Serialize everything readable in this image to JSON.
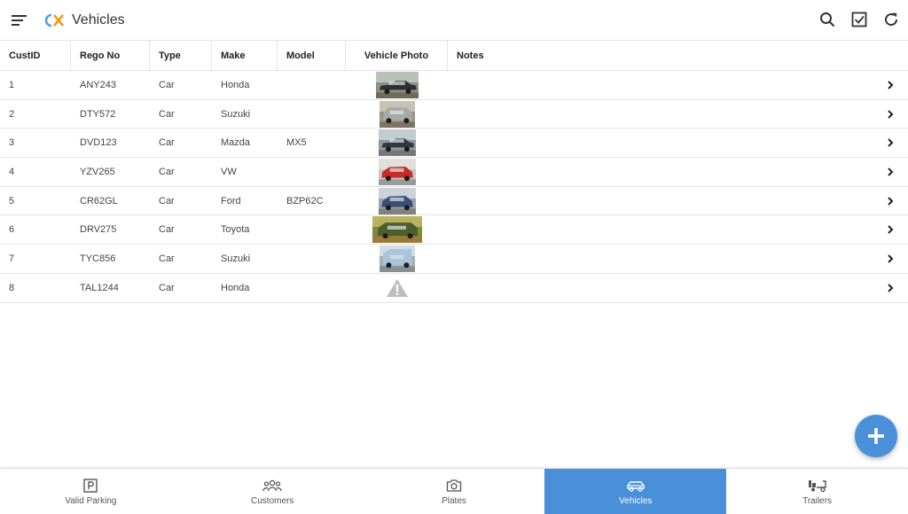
{
  "app": {
    "title": "Vehicles",
    "logo_text": "CX",
    "accent": "#4a90d9"
  },
  "table": {
    "columns": [
      "CustID",
      "Rego No",
      "Type",
      "Make",
      "Model",
      "Vehicle Photo",
      "Notes"
    ],
    "rows": [
      {
        "custid": "1",
        "rego": "ANY243",
        "type": "Car",
        "make": "Honda",
        "model": "",
        "photo": "sedan-dark",
        "notes": ""
      },
      {
        "custid": "2",
        "rego": "DTY572",
        "type": "Car",
        "make": "Suzuki",
        "model": "",
        "photo": "suv-silver",
        "notes": ""
      },
      {
        "custid": "3",
        "rego": "DVD123",
        "type": "Car",
        "make": "Mazda",
        "model": "MX5",
        "photo": "convertible-dark",
        "notes": ""
      },
      {
        "custid": "4",
        "rego": "YZV265",
        "type": "Car",
        "make": "VW",
        "model": "",
        "photo": "hatch-red",
        "notes": ""
      },
      {
        "custid": "5",
        "rego": "CR62GL",
        "type": "Car",
        "make": "Ford",
        "model": "BZP62C",
        "photo": "hatch-blue",
        "notes": ""
      },
      {
        "custid": "6",
        "rego": "DRV275",
        "type": "Car",
        "make": "Toyota",
        "model": "",
        "photo": "offroad-green",
        "notes": ""
      },
      {
        "custid": "7",
        "rego": "TYC856",
        "type": "Car",
        "make": "Suzuki",
        "model": "",
        "photo": "van-lightblue",
        "notes": ""
      },
      {
        "custid": "8",
        "rego": "TAL1244",
        "type": "Car",
        "make": "Honda",
        "model": "",
        "photo": "warning-icon",
        "notes": ""
      }
    ]
  },
  "nav": [
    {
      "label": "Valid Parking",
      "icon": "parking-icon",
      "active": false
    },
    {
      "label": "Customers",
      "icon": "people-icon",
      "active": false
    },
    {
      "label": "Plates",
      "icon": "camera-icon",
      "active": false
    },
    {
      "label": "Vehicles",
      "icon": "car-icon",
      "active": true
    },
    {
      "label": "Trailers",
      "icon": "trailer-icon",
      "active": false
    }
  ]
}
